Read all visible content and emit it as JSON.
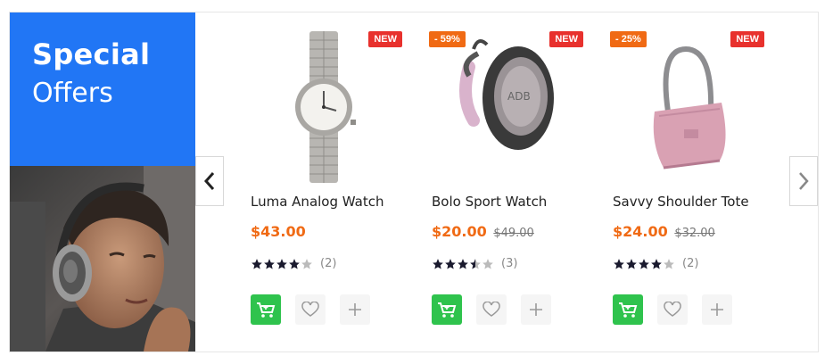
{
  "promo": {
    "title_bold": "Special",
    "title_light": "Offers",
    "color": "#2176f5"
  },
  "navigation": {
    "prev_icon": "chevron-left-icon",
    "next_icon": "chevron-right-icon"
  },
  "products": [
    {
      "name": "Luma Analog Watch",
      "price": "$43.00",
      "old_price": "",
      "badge_new": "NEW",
      "badge_sale": "",
      "rating": 4,
      "review_count": "(2)"
    },
    {
      "name": "Bolo Sport Watch",
      "price": "$20.00",
      "old_price": "$49.00",
      "badge_new": "NEW",
      "badge_sale": "- 59%",
      "rating": 3.5,
      "review_count": "(3)"
    },
    {
      "name": "Savvy Shoulder Tote",
      "price": "$24.00",
      "old_price": "$32.00",
      "badge_new": "NEW",
      "badge_sale": "- 25%",
      "rating": 4,
      "review_count": "(2)"
    }
  ],
  "colors": {
    "price": "#f06a14",
    "badge_new": "#e8312d",
    "badge_sale": "#f06a14",
    "cart_button": "#2fc34d",
    "star_filled": "#1a1a2e",
    "star_empty": "#bbbbbb"
  }
}
